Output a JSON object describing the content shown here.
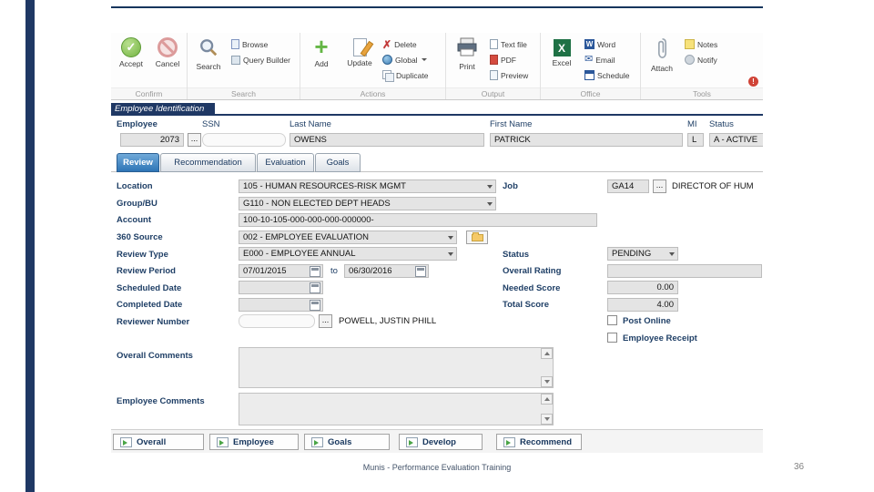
{
  "icons": {
    "check": "✓",
    "x_mark": "✗",
    "plus": "+",
    "envelope": "✉",
    "excel_letter": "X",
    "word_letter": "W",
    "exclamation": "!"
  },
  "ui": {
    "ellipsis": "..."
  },
  "toolbar": {
    "accept": "Accept",
    "cancel": "Cancel",
    "search": "Search",
    "browse": "Browse",
    "query_builder": "Query Builder",
    "add": "Add",
    "update": "Update",
    "delete": "Delete",
    "global": "Global",
    "duplicate": "Duplicate",
    "print": "Print",
    "text_file": "Text file",
    "pdf": "PDF",
    "preview": "Preview",
    "excel": "Excel",
    "word": "Word",
    "email": "Email",
    "schedule": "Schedule",
    "attach": "Attach",
    "notes": "Notes",
    "notify": "Notify",
    "section_confirm": "Confirm",
    "section_search": "Search",
    "section_actions": "Actions",
    "section_output": "Output",
    "section_office": "Office",
    "section_tools": "Tools"
  },
  "identification": {
    "header": "Employee Identification",
    "employee_label": "Employee",
    "ssn_label": "SSN",
    "last_name_label": "Last Name",
    "first_name_label": "First Name",
    "mi_label": "MI",
    "status_label": "Status",
    "employee_value": "2073",
    "ssn_value": "",
    "last_name_value": "OWENS",
    "first_name_value": "PATRICK",
    "mi_value": "L",
    "status_value": "A - ACTIVE"
  },
  "tabs": [
    {
      "label": "Review"
    },
    {
      "label": "Recommendation"
    },
    {
      "label": "Evaluation"
    },
    {
      "label": "Goals"
    }
  ],
  "form": {
    "location_label": "Location",
    "location_value": "105 - HUMAN RESOURCES-RISK MGMT",
    "job_label": "Job",
    "job_code": "GA14",
    "job_desc": "DIRECTOR OF HUM",
    "group_label": "Group/BU",
    "group_value": "G110 - NON ELECTED DEPT HEADS",
    "account_label": "Account",
    "account_value": "100-10-105-000-000-000-000000-",
    "source_label": "360 Source",
    "source_value": "002 - EMPLOYEE EVALUATION",
    "review_type_label": "Review Type",
    "review_type_value": "E000 - EMPLOYEE ANNUAL",
    "status_label": "Status",
    "status_value": "PENDING",
    "review_period_label": "Review Period",
    "period_start": "07/01/2015",
    "period_to": "to",
    "period_end": "06/30/2016",
    "overall_rating_label": "Overall Rating",
    "overall_rating_value": "",
    "scheduled_date_label": "Scheduled Date",
    "scheduled_date_value": "",
    "needed_score_label": "Needed Score",
    "needed_score_value": "0.00",
    "completed_date_label": "Completed Date",
    "completed_date_value": "",
    "total_score_label": "Total Score",
    "total_score_value": "4.00",
    "reviewer_label": "Reviewer Number",
    "reviewer_value": "",
    "reviewer_name": "POWELL, JUSTIN PHILL",
    "post_online_label": "Post Online",
    "employee_receipt_label": "Employee Receipt",
    "overall_comments_label": "Overall Comments",
    "overall_comments_value": "",
    "employee_comments_label": "Employee Comments",
    "employee_comments_value": ""
  },
  "footer_buttons": [
    "Overall",
    "Employee",
    "Goals",
    "Develop",
    "Recommend"
  ],
  "slide": {
    "caption": "Munis - Performance Evaluation Training",
    "page_number": "36"
  }
}
